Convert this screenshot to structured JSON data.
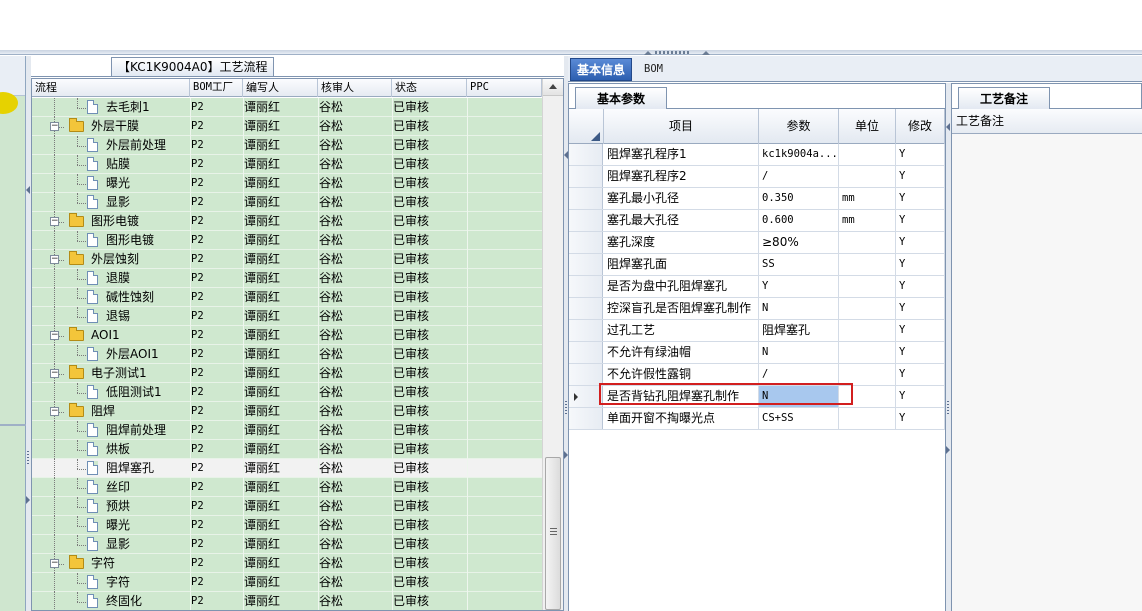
{
  "process_panel": {
    "title": "【KC1K9004A0】工艺流程",
    "columns": [
      "流程",
      "BOM工厂",
      "编写人",
      "核审人",
      "状态",
      "PPC"
    ],
    "rows": [
      {
        "name": "去毛刺1",
        "level": 2,
        "type": "doc",
        "bom": "P2",
        "writer": "谭丽红",
        "reviewer": "谷松",
        "status": "已审核"
      },
      {
        "name": "外层干膜",
        "level": 1,
        "type": "folder",
        "bom": "P2",
        "writer": "谭丽红",
        "reviewer": "谷松",
        "status": "已审核"
      },
      {
        "name": "外层前处理",
        "level": 2,
        "type": "doc",
        "bom": "P2",
        "writer": "谭丽红",
        "reviewer": "谷松",
        "status": "已审核"
      },
      {
        "name": "贴膜",
        "level": 2,
        "type": "doc",
        "bom": "P2",
        "writer": "谭丽红",
        "reviewer": "谷松",
        "status": "已审核"
      },
      {
        "name": "曝光",
        "level": 2,
        "type": "doc",
        "bom": "P2",
        "writer": "谭丽红",
        "reviewer": "谷松",
        "status": "已审核"
      },
      {
        "name": "显影",
        "level": 2,
        "type": "doc",
        "bom": "P2",
        "writer": "谭丽红",
        "reviewer": "谷松",
        "status": "已审核"
      },
      {
        "name": "图形电镀",
        "level": 1,
        "type": "folder",
        "bom": "P2",
        "writer": "谭丽红",
        "reviewer": "谷松",
        "status": "已审核"
      },
      {
        "name": "图形电镀",
        "level": 2,
        "type": "doc",
        "bom": "P2",
        "writer": "谭丽红",
        "reviewer": "谷松",
        "status": "已审核"
      },
      {
        "name": "外层蚀刻",
        "level": 1,
        "type": "folder",
        "bom": "P2",
        "writer": "谭丽红",
        "reviewer": "谷松",
        "status": "已审核"
      },
      {
        "name": "退膜",
        "level": 2,
        "type": "doc",
        "bom": "P2",
        "writer": "谭丽红",
        "reviewer": "谷松",
        "status": "已审核"
      },
      {
        "name": "碱性蚀刻",
        "level": 2,
        "type": "doc",
        "bom": "P2",
        "writer": "谭丽红",
        "reviewer": "谷松",
        "status": "已审核"
      },
      {
        "name": "退锡",
        "level": 2,
        "type": "doc",
        "bom": "P2",
        "writer": "谭丽红",
        "reviewer": "谷松",
        "status": "已审核"
      },
      {
        "name": "AOI1",
        "level": 1,
        "type": "folder",
        "bom": "P2",
        "writer": "谭丽红",
        "reviewer": "谷松",
        "status": "已审核"
      },
      {
        "name": "外层AOI1",
        "level": 2,
        "type": "doc",
        "bom": "P2",
        "writer": "谭丽红",
        "reviewer": "谷松",
        "status": "已审核"
      },
      {
        "name": "电子测试1",
        "level": 1,
        "type": "folder",
        "bom": "P2",
        "writer": "谭丽红",
        "reviewer": "谷松",
        "status": "已审核"
      },
      {
        "name": "低阻测试1",
        "level": 2,
        "type": "doc",
        "bom": "P2",
        "writer": "谭丽红",
        "reviewer": "谷松",
        "status": "已审核"
      },
      {
        "name": "阻焊",
        "level": 1,
        "type": "folder",
        "bom": "P2",
        "writer": "谭丽红",
        "reviewer": "谷松",
        "status": "已审核"
      },
      {
        "name": "阻焊前处理",
        "level": 2,
        "type": "doc",
        "bom": "P2",
        "writer": "谭丽红",
        "reviewer": "谷松",
        "status": "已审核"
      },
      {
        "name": "烘板",
        "level": 2,
        "type": "doc",
        "bom": "P2",
        "writer": "谭丽红",
        "reviewer": "谷松",
        "status": "已审核"
      },
      {
        "name": "阻焊塞孔",
        "level": 2,
        "type": "doc",
        "bom": "P2",
        "writer": "谭丽红",
        "reviewer": "谷松",
        "status": "已审核",
        "selected": true
      },
      {
        "name": "丝印",
        "level": 2,
        "type": "doc",
        "bom": "P2",
        "writer": "谭丽红",
        "reviewer": "谷松",
        "status": "已审核"
      },
      {
        "name": "预烘",
        "level": 2,
        "type": "doc",
        "bom": "P2",
        "writer": "谭丽红",
        "reviewer": "谷松",
        "status": "已审核"
      },
      {
        "name": "曝光",
        "level": 2,
        "type": "doc",
        "bom": "P2",
        "writer": "谭丽红",
        "reviewer": "谷松",
        "status": "已审核"
      },
      {
        "name": "显影",
        "level": 2,
        "type": "doc",
        "bom": "P2",
        "writer": "谭丽红",
        "reviewer": "谷松",
        "status": "已审核"
      },
      {
        "name": "字符",
        "level": 1,
        "type": "folder",
        "bom": "P2",
        "writer": "谭丽红",
        "reviewer": "谷松",
        "status": "已审核"
      },
      {
        "name": "字符",
        "level": 2,
        "type": "doc",
        "bom": "P2",
        "writer": "谭丽红",
        "reviewer": "谷松",
        "status": "已审核"
      },
      {
        "name": "终固化",
        "level": 2,
        "type": "doc",
        "bom": "P2",
        "writer": "谭丽红",
        "reviewer": "谷松",
        "status": "已审核"
      }
    ]
  },
  "info_tabs": {
    "basic": "基本信息",
    "bom": "BOM"
  },
  "params_panel": {
    "sub_tab": "基本参数",
    "columns": [
      "项目",
      "参数",
      "单位",
      "修改"
    ],
    "rows": [
      {
        "item": "阻焊塞孔程序1",
        "param": "kc1k9004a...",
        "unit": "",
        "modify": "Y"
      },
      {
        "item": "阻焊塞孔程序2",
        "param": "/",
        "unit": "",
        "modify": "Y"
      },
      {
        "item": "塞孔最小孔径",
        "param": "0.350",
        "unit": "mm",
        "modify": "Y"
      },
      {
        "item": "塞孔最大孔径",
        "param": "0.600",
        "unit": "mm",
        "modify": "Y"
      },
      {
        "item": "塞孔深度",
        "param": "≥80%",
        "unit": "",
        "modify": "Y"
      },
      {
        "item": "阻焊塞孔面",
        "param": "SS",
        "unit": "",
        "modify": "Y"
      },
      {
        "item": "是否为盘中孔阻焊塞孔",
        "param": "Y",
        "unit": "",
        "modify": "Y"
      },
      {
        "item": "控深盲孔是否阻焊塞孔制作",
        "param": "N",
        "unit": "",
        "modify": "Y"
      },
      {
        "item": "过孔工艺",
        "param": "阻焊塞孔",
        "unit": "",
        "modify": "Y"
      },
      {
        "item": "不允许有绿油帽",
        "param": "N",
        "unit": "",
        "modify": "Y"
      },
      {
        "item": "不允许假性露铜",
        "param": "/",
        "unit": "",
        "modify": "Y"
      },
      {
        "item": "是否背钻孔阻焊塞孔制作",
        "param": "N",
        "unit": "",
        "modify": "Y",
        "current": true
      },
      {
        "item": "单面开窗不掏曝光点",
        "param": "CS+SS",
        "unit": "",
        "modify": "Y"
      }
    ]
  },
  "notes_panel": {
    "tab": "工艺备注",
    "header": "工艺备注"
  },
  "colors": {
    "row_green": "#cfe8cf",
    "highlight_red": "#d21f1f",
    "tab_blue": "#2d5fb0",
    "cell_selected": "#a8c8ee"
  }
}
